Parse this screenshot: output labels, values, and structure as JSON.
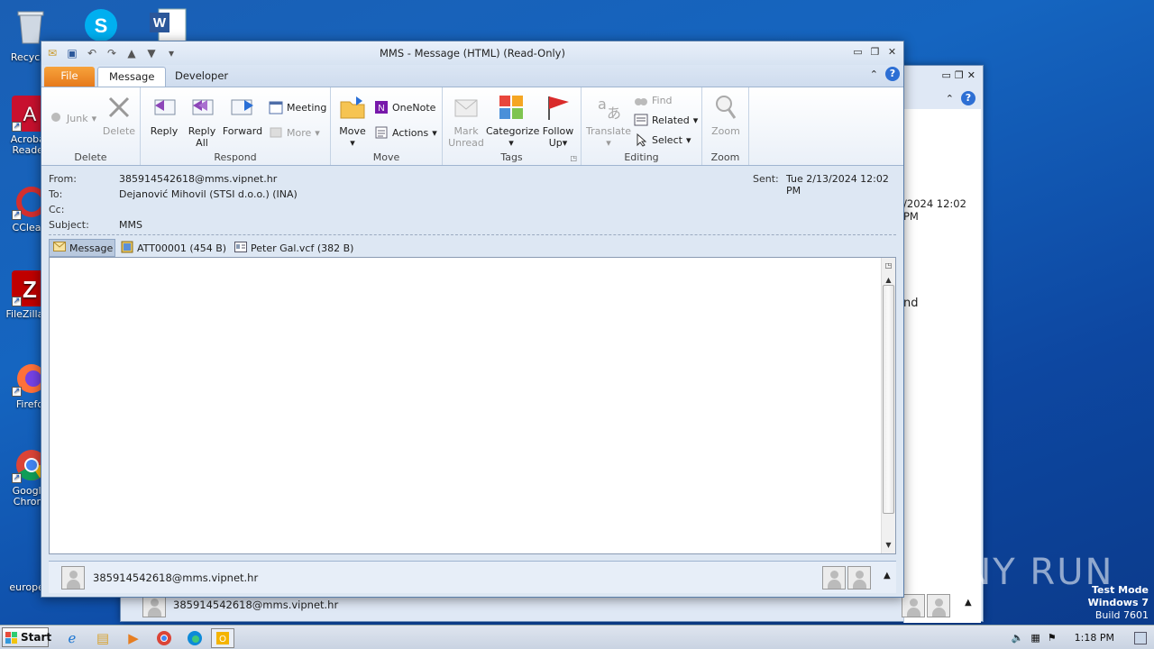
{
  "desktop": {
    "icons": [
      {
        "label": "Recycle",
        "icon": "recycle-bin-icon"
      },
      {
        "label": "Acrobat Reader",
        "icon": "acrobat-icon"
      },
      {
        "label": "CClean",
        "icon": "ccleaner-icon"
      },
      {
        "label": "FileZilla C",
        "icon": "filezilla-icon"
      },
      {
        "label": "Firefo",
        "icon": "firefox-icon"
      },
      {
        "label": "Google Chrom",
        "icon": "chrome-icon"
      },
      {
        "label": "europea",
        "icon": "file-icon"
      }
    ]
  },
  "window": {
    "title": "MMS  -  Message (HTML) (Read-Only)",
    "tabs": {
      "file": "File",
      "message": "Message",
      "developer": "Developer"
    },
    "ribbon": {
      "delete": {
        "label": "Delete",
        "junk": "Junk",
        "delete_btn": "Delete"
      },
      "respond": {
        "label": "Respond",
        "reply": "Reply",
        "reply_all_1": "Reply",
        "reply_all_2": "All",
        "forward": "Forward",
        "meeting": "Meeting",
        "more": "More"
      },
      "move": {
        "label": "Move",
        "move_btn": "Move",
        "onenote": "OneNote",
        "actions": "Actions"
      },
      "tags": {
        "label": "Tags",
        "mark_1": "Mark",
        "mark_2": "Unread",
        "categorize": "Categorize",
        "follow_1": "Follow",
        "follow_2": "Up"
      },
      "editing": {
        "label": "Editing",
        "translate": "Translate",
        "find": "Find",
        "related": "Related",
        "select": "Select"
      },
      "zoom": {
        "label": "Zoom",
        "zoom_btn": "Zoom"
      }
    },
    "header": {
      "from_label": "From:",
      "from": "385914542618@mms.vipnet.hr",
      "to_label": "To:",
      "to": "Dejanović Mihovil (STSI d.o.o.) (INA)",
      "cc_label": "Cc:",
      "cc": "",
      "subject_label": "Subject:",
      "subject": "MMS",
      "sent_label": "Sent:",
      "sent": "Tue 2/13/2024 12:02 PM"
    },
    "attachments": [
      {
        "label": "Message"
      },
      {
        "label": "ATT00001 (454 B)"
      },
      {
        "label": "Peter Gal.vcf (382 B)"
      }
    ],
    "people_pane": {
      "sender": "385914542618@mms.vipnet.hr"
    }
  },
  "background_window": {
    "sent_fragment": "/2024 12:02 PM",
    "body_fragment": "nd",
    "sender": "385914542618@mms.vipnet.hr"
  },
  "taskbar": {
    "start": "Start",
    "clock": "1:18 PM"
  },
  "watermark": {
    "line1": "Test Mode",
    "line2": "Windows 7",
    "line3": "Build 7601",
    "brand": "ANY RUN"
  }
}
